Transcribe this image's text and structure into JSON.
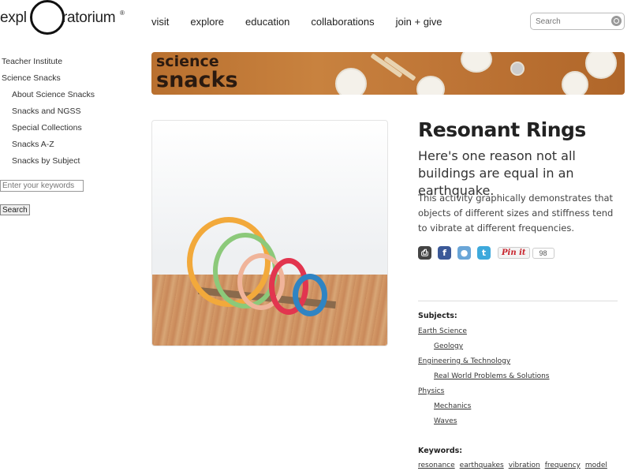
{
  "header": {
    "logo_left": "expl",
    "logo_right": "ratorium",
    "logo_trademark": "®",
    "nav": [
      "visit",
      "explore",
      "education",
      "collaborations",
      "join + give"
    ],
    "search_placeholder": "Search"
  },
  "sidebar": {
    "items": [
      {
        "label": "Teacher Institute",
        "level": 0
      },
      {
        "label": "Science Snacks",
        "level": 0
      },
      {
        "label": "About Science Snacks",
        "level": 1
      },
      {
        "label": "Snacks and NGSS",
        "level": 1
      },
      {
        "label": "Special Collections",
        "level": 1
      },
      {
        "label": "Snacks A-Z",
        "level": 1
      },
      {
        "label": "Snacks by Subject",
        "level": 1
      }
    ],
    "keyword_placeholder": "Enter your keywords",
    "search_button": "Search"
  },
  "banner": {
    "line1": "science",
    "line2": "snacks"
  },
  "article": {
    "title": "Resonant Rings",
    "subtitle": "Here's one reason not all buildings are equal in an earthquake.",
    "description": "This activity graphically demonstrates that objects of different sizes and stiffness tend to vibrate at different frequencies.",
    "pin_label": "Pin it",
    "pin_count": "98"
  },
  "subjects": {
    "heading": "Subjects:",
    "tags": [
      {
        "label": "Earth Science",
        "level": 0
      },
      {
        "label": "Geology",
        "level": 1
      },
      {
        "label": "Engineering & Technology",
        "level": 0
      },
      {
        "label": "Real World Problems & Solutions",
        "level": 1
      },
      {
        "label": "Physics",
        "level": 0
      },
      {
        "label": "Mechanics",
        "level": 1
      },
      {
        "label": "Waves",
        "level": 1
      }
    ]
  },
  "keywords": {
    "heading": "Keywords:",
    "items": [
      "resonance",
      "earthquakes",
      "vibration",
      "frequency",
      "model"
    ]
  },
  "colors": {
    "ring_colors": [
      "#f2a93b",
      "#8cc97a",
      "#f0b49a",
      "#e2354f",
      "#2f84c3"
    ]
  }
}
